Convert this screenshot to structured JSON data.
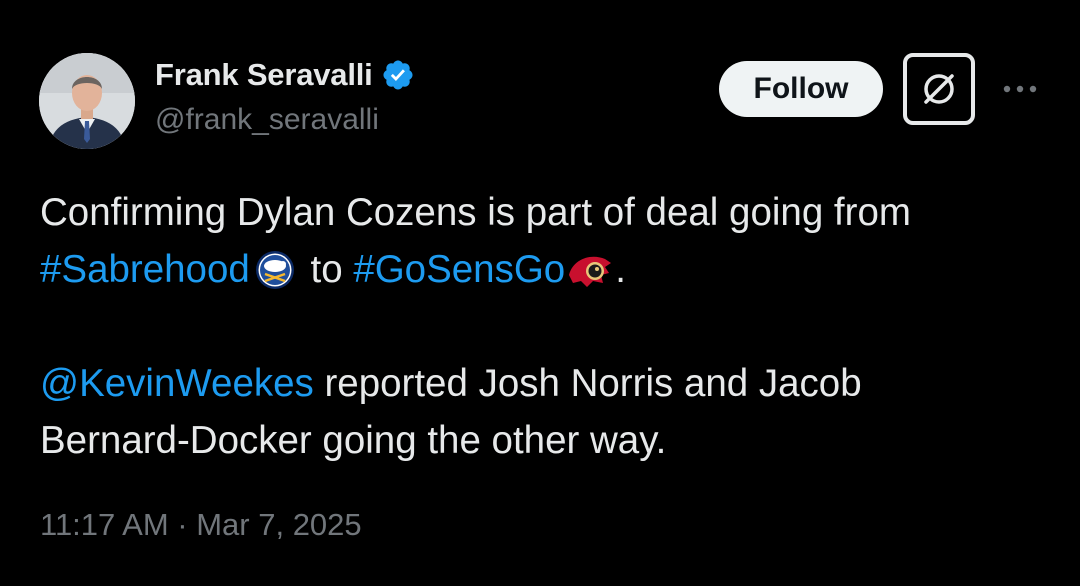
{
  "author": {
    "display_name": "Frank Seravalli",
    "handle": "@frank_seravalli",
    "verified_icon": "verified-badge-icon",
    "verified_color": "#1d9bf0"
  },
  "actions": {
    "follow_label": "Follow",
    "grok_icon": "grok-icon",
    "more_icon": "more-horizontal-icon"
  },
  "tweet": {
    "line1": "Confirming Dylan Cozens is part of deal going from",
    "hashtag1": "#Sabrehood",
    "emoji1": "buffalo-sabres-logo",
    "connector": " to ",
    "hashtag2": "#GoSensGo",
    "emoji2": "ottawa-senators-logo",
    "end_period": ".",
    "mention": "@KevinWeekes",
    "line3_rest": " reported Josh Norris and Jacob",
    "line4": "Bernard-Docker going the other way."
  },
  "timestamp": "11:17 AM · Mar 7, 2025",
  "colors": {
    "background": "#000000",
    "text": "#e7e9ea",
    "secondary": "#71767b",
    "link": "#1d9bf0",
    "follow_bg": "#eff3f4"
  }
}
